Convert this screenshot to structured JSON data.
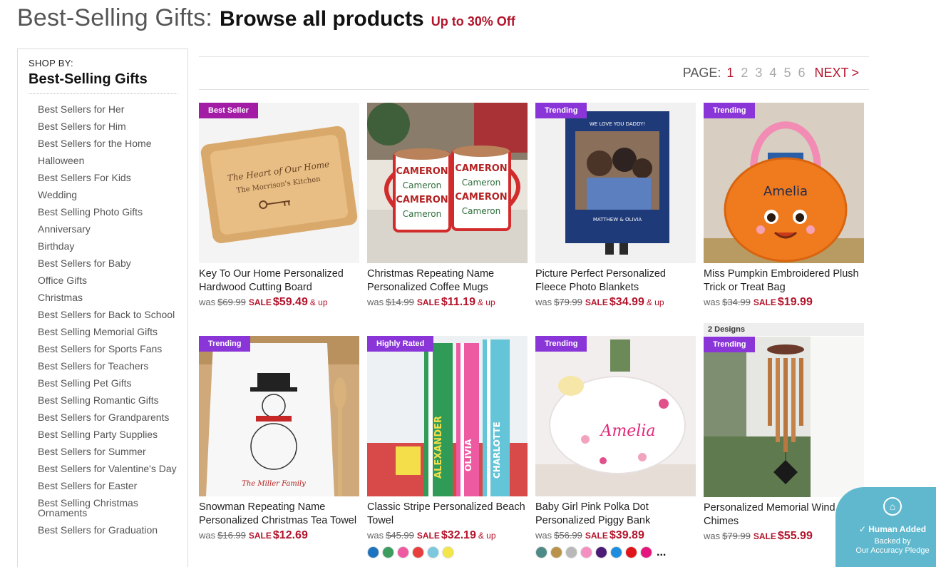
{
  "header": {
    "title_light": "Best-Selling Gifts:",
    "title_bold": "Browse all products",
    "offer": "Up to 30% Off"
  },
  "sidebar": {
    "shop_by": "SHOP BY:",
    "title": "Best-Selling Gifts",
    "items": [
      "Best Sellers for Her",
      "Best Sellers for Him",
      "Best Sellers for the Home",
      "Halloween",
      "Best Sellers For Kids",
      "Wedding",
      "Best Selling Photo Gifts",
      "Anniversary",
      "Birthday",
      "Best Sellers for Baby",
      "Office Gifts",
      "Christmas",
      "Best Sellers for Back to School",
      "Best Selling Memorial Gifts",
      "Best Sellers for Sports Fans",
      "Best Sellers for Teachers",
      "Best Selling Pet Gifts",
      "Best Selling Romantic Gifts",
      "Best Sellers for Grandparents",
      "Best Selling Party Supplies",
      "Best Sellers for Summer",
      "Best Sellers for Valentine's Day",
      "Best Sellers for Easter",
      "Best Selling Christmas Ornaments",
      "Best Sellers for Graduation"
    ]
  },
  "pager": {
    "label": "PAGE:",
    "pages": [
      "1",
      "2",
      "3",
      "4",
      "5",
      "6"
    ],
    "current": "1",
    "next": "NEXT",
    "chevron": ">"
  },
  "products": [
    {
      "badge": "Best Seller",
      "name": "Key To Our Home Personalized Hardwood Cutting Board",
      "was_label": "was",
      "was_price": "$69.99",
      "sale_label": "SALE",
      "sale_price": "$59.49",
      "suffix": "& up",
      "image_text_1": "The Heart of Our Home",
      "image_text_2": "The Morrison's Kitchen"
    },
    {
      "badge": "",
      "name": "Christmas Repeating Name Personalized Coffee Mugs",
      "was_label": "was",
      "was_price": "$14.99",
      "sale_label": "SALE",
      "sale_price": "$11.19",
      "suffix": "& up",
      "image_text_1": "CAMERON",
      "image_text_2": "Cameron"
    },
    {
      "badge": "Trending",
      "name": "Picture Perfect Personalized Fleece Photo Blankets",
      "was_label": "was",
      "was_price": "$79.99",
      "sale_label": "SALE",
      "sale_price": "$34.99",
      "suffix": "& up",
      "image_text_1": "WE LOVE YOU DADDY!",
      "image_text_2": "MATTHEW & OLIVIA"
    },
    {
      "badge": "Trending",
      "name": "Miss Pumpkin Embroidered Plush Trick or Treat Bag",
      "was_label": "was",
      "was_price": "$34.99",
      "sale_label": "SALE",
      "sale_price": "$19.99",
      "suffix": "",
      "image_text_1": "Amelia"
    },
    {
      "badge": "Trending",
      "name": "Snowman Repeating Name Personalized Christmas Tea Towel",
      "was_label": "was",
      "was_price": "$16.99",
      "sale_label": "SALE",
      "sale_price": "$12.69",
      "suffix": "",
      "image_text_1": "The Miller Family"
    },
    {
      "badge": "Highly Rated",
      "name": "Classic Stripe Personalized Beach Towel",
      "was_label": "was",
      "was_price": "$45.99",
      "sale_label": "SALE",
      "sale_price": "$32.19",
      "suffix": "& up",
      "image_text_1": "ALEXANDER",
      "image_text_2": "OLIVIA",
      "image_text_3": "CHARLOTTE",
      "swatches": [
        "#1e73be",
        "#3a9d5d",
        "#ee5aa1",
        "#e83e3e",
        "#7cc8dc",
        "#f2e64a"
      ]
    },
    {
      "badge": "Trending",
      "name": "Baby Girl Pink Polka Dot Personalized Piggy Bank",
      "was_label": "was",
      "was_price": "$56.99",
      "sale_label": "SALE",
      "sale_price": "$39.89",
      "suffix": "",
      "image_text_1": "Amelia",
      "swatches": [
        "#4e8a87",
        "#b9934a",
        "#b8b8b8",
        "#f48fc1",
        "#4b1b77",
        "#1e8de0",
        "#e0151b",
        "#e5177e"
      ],
      "more": "..."
    },
    {
      "badge": "Trending",
      "designs": "2 Designs",
      "name": "Personalized Memorial Wind Chimes",
      "was_label": "was",
      "was_price": "$79.99",
      "sale_label": "SALE",
      "sale_price": "$55.99",
      "suffix": ""
    }
  ],
  "pledge": {
    "line1": "Human Added",
    "line2": "Backed by",
    "line3": "Our Accuracy Pledge"
  },
  "colors": {
    "accent_red": "#b3142b",
    "badge_purple": "#8a35d8",
    "badge_magenta": "#a21ca6",
    "pledge_blue": "#5fb8ce"
  }
}
